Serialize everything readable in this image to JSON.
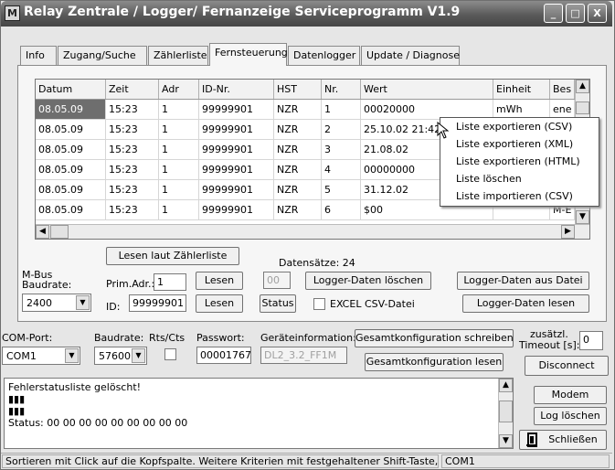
{
  "window": {
    "title": "Relay Zentrale / Logger/ Fernanzeige Serviceprogramm  V1.9",
    "app_icon": "M",
    "minimize": "_",
    "maximize": "□",
    "close": "X"
  },
  "tabs": [
    {
      "label": "Info"
    },
    {
      "label": "Zugang/Suche"
    },
    {
      "label": "Zählerliste"
    },
    {
      "label": "Fernsteuerung"
    },
    {
      "label": "Datenlogger"
    },
    {
      "label": "Update / Diagnose"
    }
  ],
  "grid": {
    "columns": [
      "Datum",
      "Zeit",
      "Adr",
      "ID-Nr.",
      "HST",
      "Nr.",
      "Wert",
      "Einheit",
      "Bes"
    ],
    "rows": [
      [
        "08.05.09",
        "15:23",
        "1",
        "99999901",
        "NZR",
        "1",
        "00020000",
        "mWh",
        "ene"
      ],
      [
        "08.05.09",
        "15:23",
        "1",
        "99999901",
        "NZR",
        "2",
        "25.10.02 21:42",
        "",
        ""
      ],
      [
        "08.05.09",
        "15:23",
        "1",
        "99999901",
        "NZR",
        "3",
        "21.08.02",
        "",
        ""
      ],
      [
        "08.05.09",
        "15:23",
        "1",
        "99999901",
        "NZR",
        "4",
        "00000000",
        "",
        ""
      ],
      [
        "08.05.09",
        "15:23",
        "1",
        "99999901",
        "NZR",
        "5",
        "31.12.02",
        "",
        ""
      ],
      [
        "08.05.09",
        "15:23",
        "1",
        "99999901",
        "NZR",
        "6",
        "$00",
        "",
        "M-E"
      ]
    ]
  },
  "context_menu": [
    "Liste exportieren (CSV)",
    "Liste exportieren (XML)",
    "Liste exportieren (HTML)",
    "Liste löschen",
    "Liste importieren (CSV)"
  ],
  "mbus": {
    "lesen_laut_label": "Lesen laut Zählerliste",
    "datensaetze": "Datensätze: 24",
    "baudrate_label_1": "M-Bus",
    "baudrate_label_2": "Baudrate:",
    "baudrate_value": "2400",
    "prim_adr_label": "Prim.Adr.:",
    "prim_adr_value": "1",
    "id_label": "ID:",
    "id_value": "99999901",
    "lesen": "Lesen",
    "small_input": "00",
    "logger_loeschen": "Logger-Daten löschen",
    "logger_aus_datei": "Logger-Daten aus Datei",
    "status_btn": "Status",
    "excel_label": "EXCEL CSV-Datei",
    "logger_lesen": "Logger-Daten lesen"
  },
  "com": {
    "port_label": "COM-Port:",
    "port_value": "COM1",
    "baud_label": "Baudrate:",
    "baud_value": "57600",
    "rtscts_label": "Rts/Cts",
    "pw_label": "Passwort:",
    "pw_value": "00001767",
    "geraeteinfo_label": "Geräteinformation:",
    "geraeteinfo_value": "DL2_3.2_FF1M",
    "gesamt_schreiben": "Gesamtkonfiguration schreiben",
    "gesamt_lesen": "Gesamtkonfiguration lesen",
    "timeout_label_1": "zusätzl.",
    "timeout_label_2": "Timeout [s]:",
    "timeout_value": "0",
    "disconnect": "Disconnect"
  },
  "log": {
    "text": "Fehlerstatusliste gelöscht!\n▮▮▮\n▮▮▮\nStatus: 00 00 00 00 00 00 00 00 00"
  },
  "side_buttons": {
    "modem": "Modem",
    "log_loeschen": "Log löschen",
    "schliessen": "Schließen"
  },
  "statusbar": {
    "hint": "Sortieren mit Click auf die Kopfspalte. Weitere Kriterien mit festgehaltener Shift-Taste,",
    "port": "COM1"
  }
}
